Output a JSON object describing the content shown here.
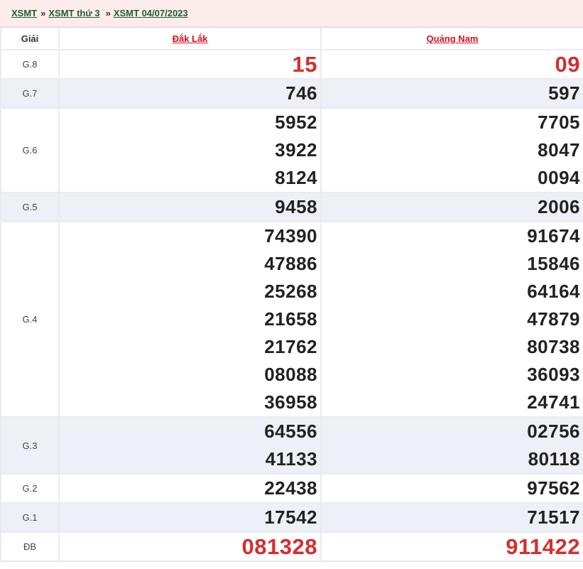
{
  "breadcrumb": {
    "items": [
      "XSMT",
      "XSMT thứ 3",
      "XSMT 04/07/2023"
    ],
    "separator": "»"
  },
  "table": {
    "prize_header": "Giải",
    "provinces": [
      "Đắk Lắk",
      "Quảng Nam"
    ],
    "rows": [
      {
        "prize": "G.8",
        "col1": [
          "15"
        ],
        "col2": [
          "09"
        ]
      },
      {
        "prize": "G.7",
        "col1": [
          "746"
        ],
        "col2": [
          "597"
        ]
      },
      {
        "prize": "G.6",
        "col1": [
          "5952",
          "3922",
          "8124"
        ],
        "col2": [
          "7705",
          "8047",
          "0094"
        ]
      },
      {
        "prize": "G.5",
        "col1": [
          "9458"
        ],
        "col2": [
          "2006"
        ]
      },
      {
        "prize": "G.4",
        "col1": [
          "74390",
          "47886",
          "25268",
          "21658",
          "21762",
          "08088",
          "36958"
        ],
        "col2": [
          "91674",
          "15846",
          "64164",
          "47879",
          "80738",
          "36093",
          "24741"
        ]
      },
      {
        "prize": "G.3",
        "col1": [
          "64556",
          "41133"
        ],
        "col2": [
          "02756",
          "80118"
        ]
      },
      {
        "prize": "G.2",
        "col1": [
          "22438"
        ],
        "col2": [
          "97562"
        ]
      },
      {
        "prize": "G.1",
        "col1": [
          "17542"
        ],
        "col2": [
          "71517"
        ]
      },
      {
        "prize": "ĐB",
        "col1": [
          "081328"
        ],
        "col2": [
          "911422"
        ]
      }
    ]
  },
  "colors": {
    "breadcrumb_bg": "#fdecec",
    "link_green": "#1f5f2e",
    "province_red": "#d6111d",
    "highlight_red": "#d32f2f",
    "row_shade": "#eef0f7"
  }
}
